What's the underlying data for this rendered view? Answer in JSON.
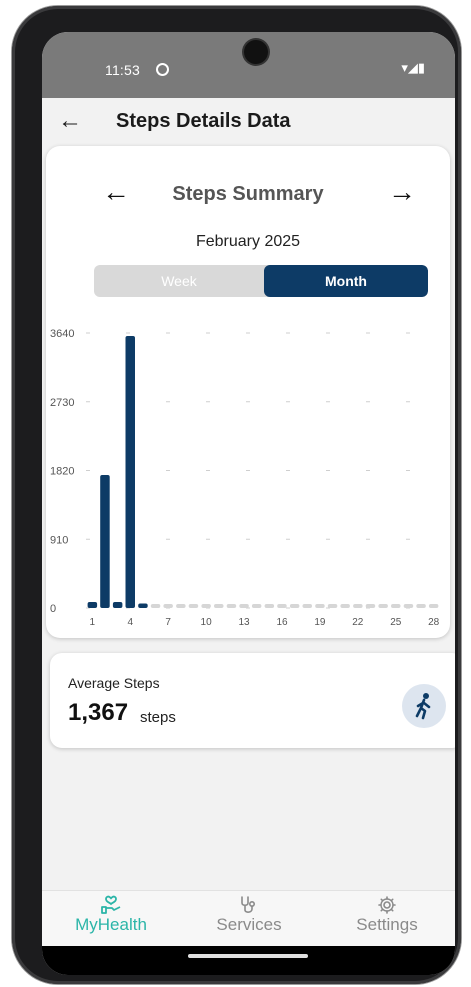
{
  "status": {
    "time": "11:53",
    "icons": "▾◢▮"
  },
  "appbar": {
    "title": "Steps Details Data",
    "back_symbol": "←"
  },
  "summary": {
    "title": "Steps Summary",
    "month": "February 2025",
    "prev_symbol": "←",
    "next_symbol": "→",
    "toggle": {
      "week_label": "Week",
      "month_label": "Month",
      "selected": "Month"
    }
  },
  "chart_data": {
    "type": "bar",
    "categories": [
      "1",
      "2",
      "3",
      "4",
      "5",
      "6",
      "7",
      "8",
      "9",
      "10",
      "11",
      "12",
      "13",
      "14",
      "15",
      "16",
      "17",
      "18",
      "19",
      "20",
      "21",
      "22",
      "23",
      "24",
      "25",
      "26",
      "27",
      "28"
    ],
    "values": [
      80,
      1760,
      80,
      3600,
      60,
      0,
      0,
      0,
      0,
      0,
      0,
      0,
      0,
      0,
      0,
      0,
      0,
      0,
      0,
      0,
      0,
      0,
      0,
      0,
      0,
      0,
      0,
      0
    ],
    "x_tick_labels": [
      "1",
      "4",
      "7",
      "10",
      "13",
      "16",
      "19",
      "22",
      "25",
      "28"
    ],
    "y_tick_labels": [
      "0",
      "910",
      "1820",
      "2730",
      "3640"
    ],
    "ylim": [
      0,
      3640
    ],
    "grid": true,
    "bar_color": "#0d3b66",
    "empty_bar_color": "#d6d6d6"
  },
  "average": {
    "label": "Average Steps",
    "value": "1,367",
    "unit": "steps",
    "icon": "walking-icon"
  },
  "bottom_nav": [
    {
      "label": "MyHealth",
      "icon": "hand-heart-icon",
      "active": true
    },
    {
      "label": "Services",
      "icon": "stethoscope-icon",
      "active": false
    },
    {
      "label": "Settings",
      "icon": "gear-icon",
      "active": false
    }
  ],
  "colors": {
    "accent": "#2bb5a8",
    "primary": "#0d3b66",
    "inactive": "#8a8a8a"
  }
}
